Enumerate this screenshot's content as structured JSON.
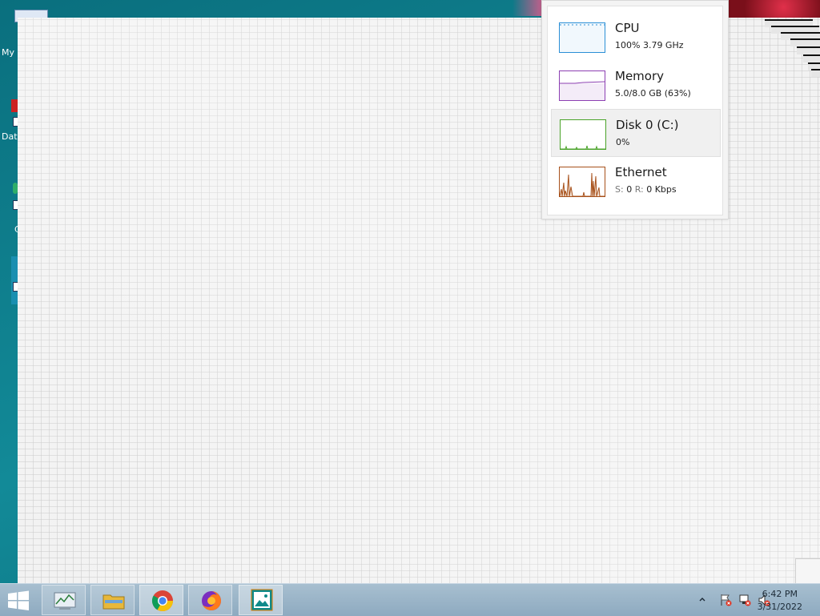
{
  "desktop": {
    "icons": [
      {
        "label": "My"
      },
      {
        "label": "Dat"
      },
      {
        "label": "C"
      }
    ]
  },
  "task_manager": {
    "items": [
      {
        "title": "CPU",
        "subtitle": "100%  3.79 GHz",
        "color": "#2b8fd6",
        "selected": false
      },
      {
        "title": "Memory",
        "subtitle": "5.0/8.0 GB (63%)",
        "color": "#8c3fb2",
        "selected": false
      },
      {
        "title": "Disk 0 (C:)",
        "subtitle": "0%",
        "color": "#4aa329",
        "selected": true
      },
      {
        "title": "Ethernet",
        "subtitle_s_label": "S:",
        "subtitle_s_value": "0",
        "subtitle_r_label": "R:",
        "subtitle_r_value": "0 Kbps",
        "color": "#a7501a",
        "selected": false
      }
    ]
  },
  "taskbar": {
    "apps": [
      {
        "name": "task-manager",
        "icon": "task-manager-icon"
      },
      {
        "name": "file-explorer",
        "icon": "folder-icon"
      },
      {
        "name": "chrome",
        "icon": "chrome-icon",
        "active": true
      },
      {
        "name": "firefox",
        "icon": "firefox-icon"
      },
      {
        "name": "photos",
        "icon": "image-icon",
        "active": true
      }
    ],
    "clock": {
      "time": "6:42 PM",
      "date": "3/31/2022"
    }
  }
}
